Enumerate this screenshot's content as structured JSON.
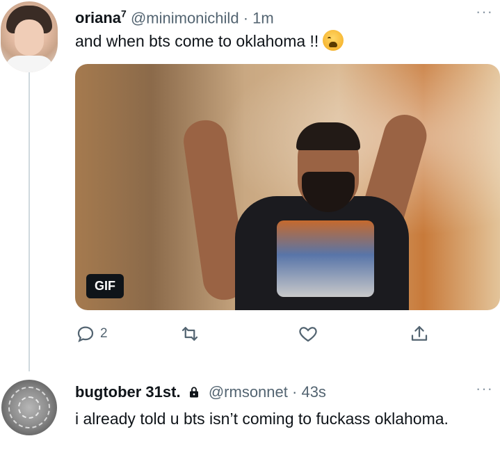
{
  "tweet1": {
    "display_name": "oriana",
    "name_sup": "7",
    "handle": "@minimonichild",
    "separator": "·",
    "time": "1m",
    "text": "and when bts come to oklahoma !!",
    "emoji": "weary-face-icon",
    "media": {
      "badge": "GIF"
    },
    "actions": {
      "reply_count": "2"
    }
  },
  "tweet2": {
    "display_name": "bugtober 31st.",
    "handle": "@rmsonnet",
    "separator": "·",
    "time": "43s",
    "text": "i already told u bts isn’t coming to fuckass oklahoma."
  },
  "more_label": "···",
  "colors": {
    "secondary_text": "#536471",
    "thread_line": "#cfd9de",
    "primary_text": "#0f1419"
  }
}
